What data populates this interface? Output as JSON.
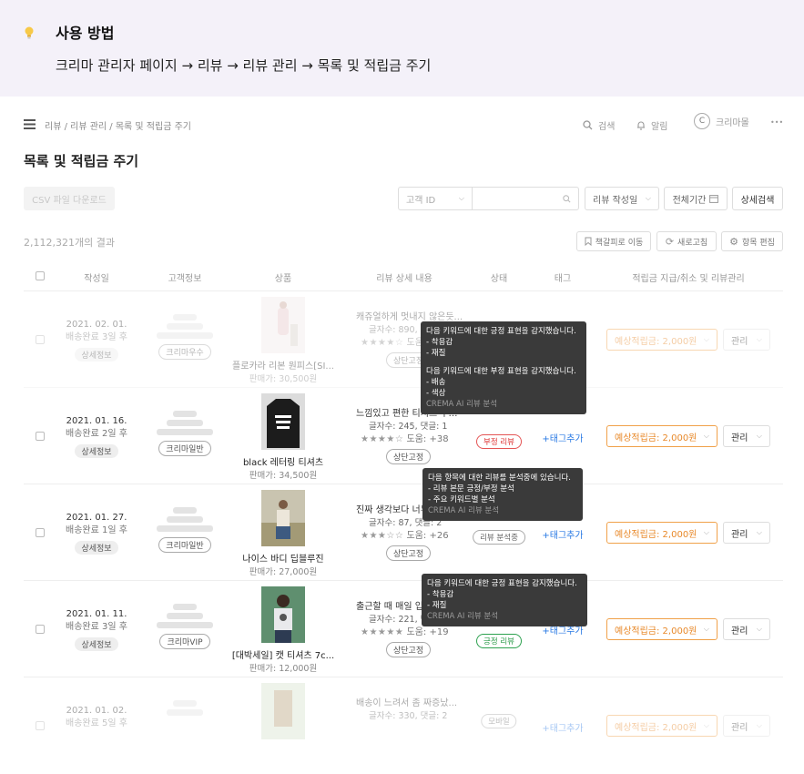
{
  "guide": {
    "title": "사용 방법",
    "path": "크리마 관리자 페이지 → 리뷰 → 리뷰 관리 → 목록 및 적립금 주기"
  },
  "topbar": {
    "breadcrumb": "리뷰 / 리뷰 관리 / 목록 및 적립금 주기",
    "search": "검색",
    "alerts": "알림",
    "avatar_letter": "C",
    "user": "크리마몰",
    "more": "•••"
  },
  "page_title": "목록 및 적립금 주기",
  "toolbar": {
    "csv_download": "CSV 파일 다운로드",
    "customer_filter": "고객 ID",
    "review_date_filter": "리뷰 작성일",
    "period_filter": "전체기간",
    "detail_search": "상세검색",
    "result_count": "2,112,321개의 결과",
    "bookmark": "책갈피로 이동",
    "refresh": "새로고침",
    "edit_columns": "항목 편집"
  },
  "columns": [
    "작성일",
    "고객정보",
    "상품",
    "리뷰 상세 내용",
    "상태",
    "태그",
    "적립금 지급/취소 및 리뷰관리"
  ],
  "labels": {
    "detail": "상세정보",
    "manage": "관리",
    "review_detail": "상단고정",
    "add_tag": "+태그추가"
  },
  "rows": [
    {
      "date": "2021. 02. 01.",
      "shipping": "배송완료 3일 후",
      "member": "크리마우수",
      "product": "플로카라 리본 원피스[SI...",
      "price": "판매가: 30,500원",
      "review": "캐쥬얼하게 멋내지 않은듯...",
      "meta": "글자수: 890, 댓글: 3",
      "help": "도움: +8",
      "stars": "★★★★☆",
      "status": "",
      "tag": "",
      "points": "예상적립금: 2,000원"
    },
    {
      "date": "2021. 01. 16.",
      "shipping": "배송완료 2일 후",
      "member": "크리마일반",
      "product": "black 레터링 티셔츠",
      "price": "판매가: 34,500원",
      "review": "느낌있고 편한 티셔츠 추천해요",
      "meta": "글자수: 245, 댓글: 1",
      "help": "도움: +38",
      "stars": "★★★★☆",
      "status": "부정 리뷰",
      "tag": "+태그추가",
      "points": "예상적립금: 2,000원"
    },
    {
      "date": "2021. 01. 27.",
      "shipping": "배송완료 1일 후",
      "member": "크리마일반",
      "product": "나이스 바디 딥블루진",
      "price": "판매가: 27,000원",
      "review": "진짜 생각보다 너무 편해요",
      "meta": "글자수: 87, 댓글: 2",
      "help": "도움: +26",
      "stars": "★★★☆☆",
      "status": "리뷰 분석중",
      "tag": "+태그추가",
      "points": "예상적립금: 2,000원"
    },
    {
      "date": "2021. 01. 11.",
      "shipping": "배송완료 3일 후",
      "member": "크리마VIP",
      "product": "[대박세일] 캣 티셔츠 7c...",
      "price": "판매가: 12,000원",
      "review": "출근할 때 매일 입어요",
      "meta": "글자수: 221, 댓글: 5",
      "help": "도움: +19",
      "stars": "★★★★★",
      "status": "긍정 리뷰",
      "tag": "+태그추가",
      "points": "예상적립금: 2,000원"
    },
    {
      "date": "2021. 01. 02.",
      "shipping": "배송완료 5일 후",
      "review": "배송이 느려서 좀 짜증났...",
      "meta": "글자수: 330, 댓글: 2",
      "status": "모바일",
      "tag": "+태그추가",
      "points": "예상적립금: 2,000원"
    }
  ],
  "tooltips": {
    "t1": {
      "pos_title": "다음 키워드에 대한 긍정 표현을 감지했습니다.",
      "pos_items": [
        "- 착용감",
        "- 재질"
      ],
      "neg_title": "다음 키워드에 대한 부정 표현을 감지했습니다.",
      "neg_items": [
        "- 배송",
        "- 색상"
      ],
      "footer": "CREMA AI 리뷰 분석"
    },
    "t2": {
      "title": "다음 항목에 대한 리뷰를 분석중에 있습니다.",
      "items": [
        "- 리뷰 본문 긍정/부정 분석",
        "- 주요 키워드별 분석"
      ],
      "footer": "CREMA AI 리뷰 분석"
    },
    "t3": {
      "title": "다음 키워드에 대한 긍정 표현을 감지했습니다.",
      "items": [
        "- 착용감",
        "- 재질"
      ],
      "footer": "CREMA AI 리뷰 분석"
    }
  }
}
